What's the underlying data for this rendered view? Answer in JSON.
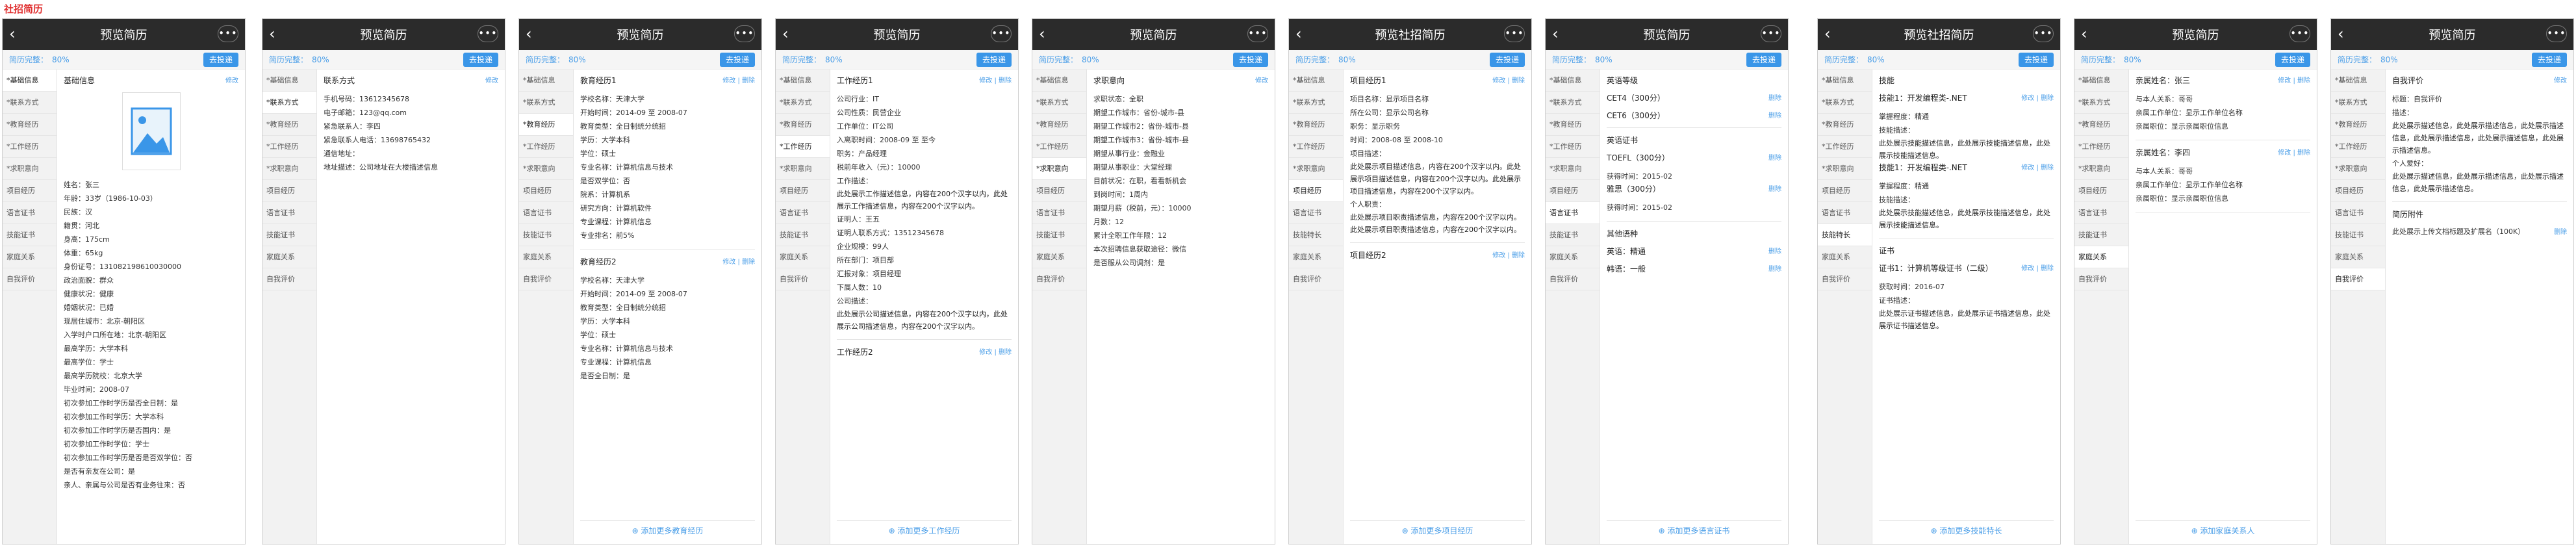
{
  "page_tag": "社招简历",
  "common": {
    "back": "‹",
    "more": "•••",
    "title": "预览简历",
    "title_social": "预览社招简历",
    "completeness_label": "简历完整：",
    "completeness_value": "80%",
    "submit_button": "去投递",
    "edit": "修改",
    "edit_delete": "修改 | 删除",
    "delete": "删除"
  },
  "sidebar": [
    "*基础信息",
    "*联系方式",
    "*教育经历",
    "*工作经历",
    "*求职意向",
    "项目经历",
    "语言证书",
    "技能证书",
    "家庭关系",
    "自我评价"
  ],
  "sidebar_social": [
    "*基础信息",
    "*联系方式",
    "*教育经历",
    "*工作经历",
    "*求职意向",
    "项目经历",
    "语言证书",
    "技能特长",
    "家庭关系",
    "自我评价"
  ],
  "s1": {
    "title": "基础信息",
    "fields": [
      "姓名：张三",
      "年龄：33岁（1986-10-03）",
      "民族：汉",
      "籍贯：河北",
      "身高：175cm",
      "体重：65kg",
      "身份证号：131082198610030000",
      "政治面貌：群众",
      "健康状况：健康",
      "婚姻状况：已婚",
      "现居住城市：北京-朝阳区",
      "入学时户口所在地：北京-朝阳区",
      "最高学历：大学本科",
      "最高学位：学士",
      "最高学历院校：北京大学",
      "毕业时间：2008-07",
      "初次参加工作时学历是否全日制：是",
      "初次参加工作时学历：大学本科",
      "初次参加工作时学历是否国内：是",
      "初次参加工作时学位：学士",
      "初次参加工作时学历是否是否双学位：否",
      "是否有亲友在公司：是",
      "亲人、亲属与公司是否有业务往来：否"
    ]
  },
  "s2": {
    "title": "联系方式",
    "fields": [
      "手机号码：13612345678",
      "电子邮箱：123@qq.com",
      "紧急联系人：李四",
      "紧急联系人电话：13698765432",
      "通信地址：",
      "地址描述：公司地址在大楼描述信息"
    ]
  },
  "s3": {
    "title1": "教育经历1",
    "fields1": [
      "学校名称：天津大学",
      "开始时间：2014-09  至  2008-07",
      "教育类型：全日制统分统招",
      "学历：大学本科",
      "学位：硕士",
      "专业名称：计算机信息与技术",
      "是否双学位：否",
      "院系：计算机系",
      "研究方向：计算机软件",
      "专业课程：计算机信息",
      "专业排名：前5%"
    ],
    "title2": "教育经历2",
    "fields2": [
      "学校名称：天津大学",
      "开始时间：2014-09  至  2008-07",
      "教育类型：全日制统分统招",
      "学历：大学本科",
      "学位：硕士",
      "专业名称：计算机信息与技术",
      "专业课程：计算机信息",
      "是否全日制：是"
    ],
    "add": "添加更多教育经历"
  },
  "s4": {
    "title1": "工作经历1",
    "fields1": [
      "公司行业：IT",
      "公司性质：民营企业",
      "工作单位：IT公司",
      "入离职时间：2008-09  至  至今",
      "职务：产品经理",
      "税前年收入（元）：10000",
      "工作描述："
    ],
    "desc": "此处展示工作描述信息，内容在200个汉字以内，此处展示工作描述信息，内容在200个汉字以内。",
    "fields2": [
      "证明人：王五",
      "证明人联系方式：13512345678",
      "企业规模：99人",
      "所在部门：项目部",
      "汇报对象：项目经理",
      "下属人数：10",
      "公司描述："
    ],
    "desc2": "此处展示公司描述信息，内容在200个汉字以内，此处展示公司描述信息，内容在200个汉字以内。",
    "title2": "工作经历2",
    "add": "添加更多工作经历"
  },
  "s5": {
    "title": "求职意向",
    "fields": [
      "求职状态：全职",
      "期望工作城市：省份-城市-县",
      "期望工作城市2：省份-城市-县",
      "期望工作城市3：省份-城市-县",
      "期望从事行业：金融业",
      "期望从事职业：大堂经理",
      "目前状况：在职，看看新机会",
      "到岗时间：1周内",
      "期望月薪（税前，元）：10000",
      "月数：12",
      "累计全职工作年限：12",
      "本次招聘信息获取途径：微信",
      "是否服从公司调剂：是"
    ]
  },
  "s6": {
    "title1": "项目经历1",
    "fields1": [
      "项目名称：显示项目名称",
      "所在公司：显示公司名称",
      "职务：显示职务",
      "时间：2008-08  至  2008-10",
      "项目描述："
    ],
    "desc1": "此处展示项目描述信息，内容在200个汉字以内。此处展示项目描述信息，内容在200个汉字以内。此处展示项目描述信息，内容在200个汉字以内。",
    "label2": "个人职责：",
    "desc2": "此处展示项目职责描述信息，内容在200个汉字以内。此处展示项目职责描述信息，内容在200个汉字以内。",
    "title2": "项目经历2",
    "add": "添加更多项目经历"
  },
  "s7": {
    "title": "英语等级",
    "items1": [
      [
        "CET4（300分）"
      ],
      [
        "CET6（300分）"
      ]
    ],
    "title2": "英语证书",
    "items2": [
      [
        "TOEFL（300分）",
        "获得时间：2015-02"
      ],
      [
        "雅思（300分）",
        "获得时间：2015-02"
      ]
    ],
    "title3": "其他语种",
    "items3": [
      [
        "英语：精通"
      ],
      [
        "韩语：一般"
      ]
    ],
    "add": "添加更多语言证书"
  },
  "s8": {
    "title": "技能",
    "items": [
      [
        "技能1：开发编程类-.NET",
        "掌握程度：精通",
        "技能描述："
      ],
      [
        "技能1：开发编程类-.NET",
        "掌握程度：精通",
        "技能描述："
      ]
    ],
    "desc": "此处展示技能描述信息，此处展示技能描述信息，此处展示技能描述信息。",
    "title2": "证书",
    "cert": [
      "证书1：计算机等级证书（二级）",
      "获取时间：2016-07",
      "证书描述："
    ],
    "cert_desc": "此处展示证书描述信息，此处展示证书描述信息，此处展示证书描述信息。",
    "add": "添加更多技能特长"
  },
  "s9": {
    "members": [
      [
        "亲属姓名：张三",
        "与本人关系：哥哥",
        "亲属工作单位：显示工作单位名称",
        "亲属职位：显示亲属职位信息"
      ],
      [
        "亲属姓名：李四",
        "与本人关系：哥哥",
        "亲属工作单位：显示工作单位名称",
        "亲属职位：显示亲属职位信息"
      ]
    ],
    "add": "添加家庭关系人"
  },
  "s10": {
    "title": "自我评价",
    "tag": "标题：自我评价",
    "label": "描述：",
    "desc": "此处展示描述信息，此处展示描述信息，此处展示描述信息，此处展示描述信息，此处展示描述信息，此处展示描述信息。",
    "label2": "个人爱好：",
    "desc2": "此处展示描述信息，此处展示描述信息，此处展示描述信息，此处展示描述信息。",
    "title2": "简历附件",
    "attach": "此处展示上传文档标题及扩展名（100K）"
  }
}
